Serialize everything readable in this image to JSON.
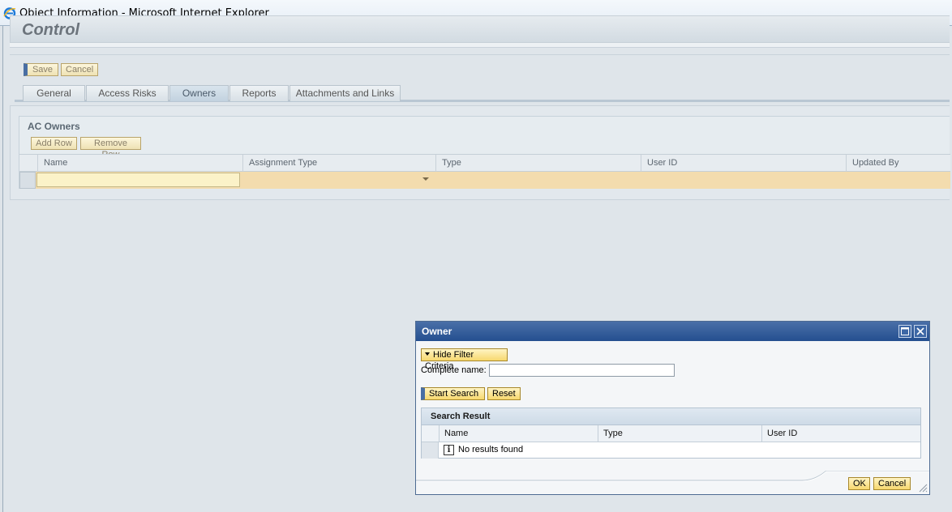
{
  "window": {
    "title": "Object Information - Microsoft Internet Explorer",
    "icon": "ie-icon"
  },
  "header": {
    "title": "Control"
  },
  "toolbar": {
    "save_label": "Save",
    "cancel_label": "Cancel"
  },
  "tabs": [
    {
      "label": "General"
    },
    {
      "label": "Access Risks"
    },
    {
      "label": "Owners",
      "selected": true
    },
    {
      "label": "Reports"
    },
    {
      "label": "Attachments and Links"
    }
  ],
  "ac_owners": {
    "title": "AC Owners",
    "add_row_label": "Add Row",
    "remove_row_label": "Remove Row",
    "columns": [
      "Name",
      "Assignment Type",
      "Type",
      "User ID",
      "Updated By"
    ]
  },
  "dialog": {
    "title": "Owner",
    "hide_filter_label": "Hide Filter Criteria",
    "complete_name_label": "Complete name:",
    "complete_name_value": "",
    "start_search_label": "Start Search",
    "reset_label": "Reset",
    "search_result": {
      "title": "Search Result",
      "columns": [
        "Name",
        "Type",
        "User ID"
      ],
      "message": "No results found"
    },
    "ok_label": "OK",
    "cancel_label": "Cancel"
  },
  "colors": {
    "dialog_title": "#244f90",
    "button_gold": "#f7d86e",
    "row_highlight": "#f3dcae"
  }
}
